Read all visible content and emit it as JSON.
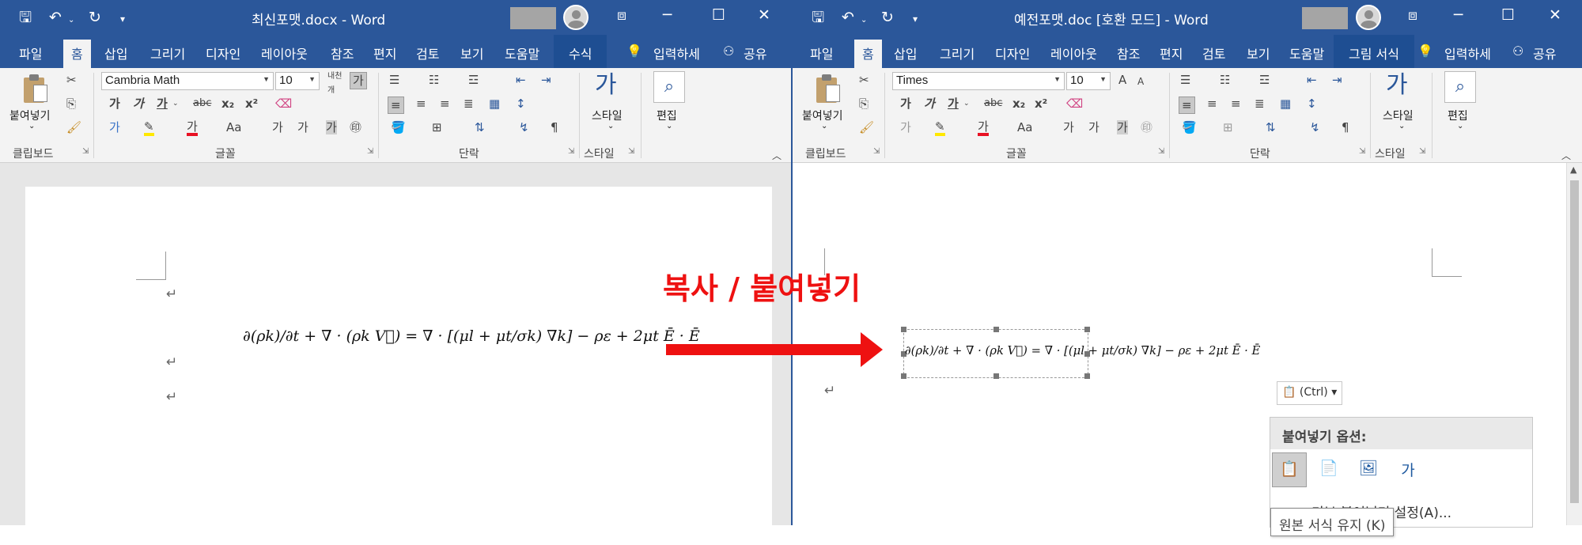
{
  "left_window": {
    "title": "최신포맷.docx  -  Word",
    "tabs": {
      "file": "파일",
      "home": "홈",
      "insert": "삽입",
      "draw": "그리기",
      "design": "디자인",
      "layout": "레이아웃",
      "references": "참조",
      "mailings": "편지",
      "review": "검토",
      "view": "보기",
      "help": "도움말",
      "context": "수식",
      "tell_me": "입력하세",
      "share": "공유"
    },
    "font_name": "Cambria Math",
    "font_size": "10",
    "groups": {
      "clipboard": "클립보드",
      "font": "글꼴",
      "paragraph": "단락",
      "styles": "스타일"
    },
    "paste_label": "붙여넣기",
    "style_label": "스타일",
    "edit_label": "편집",
    "equation": {
      "lhs": "∂(ρk)/∂t + ∇ · (ρk V⃗) = ∇ · [(μl + μt/σk) ∇k] − ρε + 2μt Ē · Ē"
    }
  },
  "right_window": {
    "title": "예전포맷.doc [호환 모드]  -  Word",
    "tabs": {
      "file": "파일",
      "home": "홈",
      "insert": "삽입",
      "draw": "그리기",
      "design": "디자인",
      "layout": "레이아웃",
      "references": "참조",
      "mailings": "편지",
      "review": "검토",
      "view": "보기",
      "help": "도움말",
      "context": "그림 서식",
      "tell_me": "입력하세",
      "share": "공유"
    },
    "font_name": "Times",
    "font_size": "10",
    "groups": {
      "clipboard": "클립보드",
      "font": "글꼴",
      "paragraph": "단락",
      "styles": "스타일"
    },
    "paste_label": "붙여넣기",
    "style_label": "스타일",
    "edit_label": "편집"
  },
  "common_ribbon": {
    "bold": "가",
    "italic": "가",
    "underline": "가",
    "strike": "abc",
    "subscript": "x₂",
    "superscript": "x²",
    "case": "Aa",
    "grow": "가",
    "shrink": "가",
    "char_border": "가",
    "circle": "㊞"
  },
  "overlay": {
    "caption": "복사 / 붙여넣기",
    "colors": {
      "accent": "#ee1111",
      "word_blue": "#2b579a"
    }
  },
  "paste_popup": {
    "ctrl_chip": "(Ctrl)",
    "header": "붙여넣기 옵션:",
    "default_item": "기본 붙여넣기 설정(A)...",
    "tooltip": "원본 서식 유지 (K)"
  },
  "icons": [
    "save-icon",
    "undo-icon",
    "redo-icon",
    "restore-icon",
    "minimize-icon",
    "maximize-icon",
    "close-icon",
    "lightbulb-icon",
    "person-icon",
    "cut-icon",
    "copy-icon",
    "format-painter-icon",
    "search-icon"
  ]
}
